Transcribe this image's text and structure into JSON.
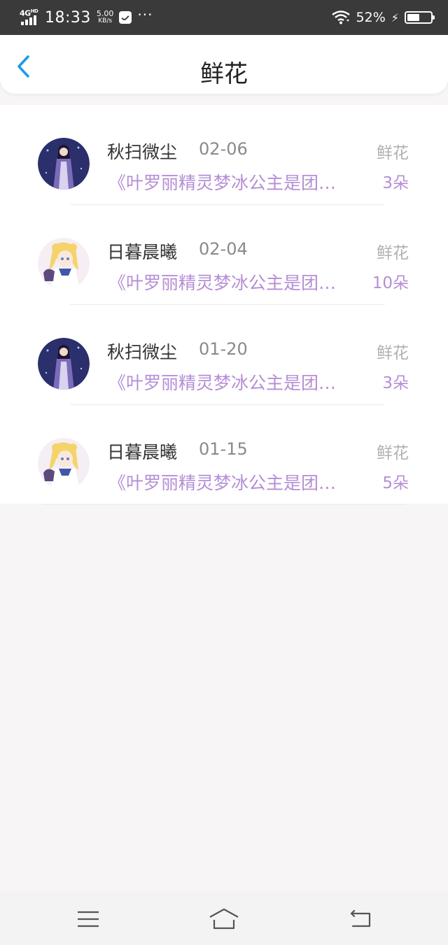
{
  "status_bar": {
    "network": "4G",
    "network_sup": "HD",
    "time": "18:33",
    "speed_value": "5.00",
    "speed_unit": "KB/s",
    "more": "···",
    "battery": "52%",
    "battery_level": 0.52,
    "icons": [
      "signal-icon",
      "message-icon",
      "wifi-icon",
      "charging-icon",
      "battery-icon"
    ]
  },
  "header": {
    "title": "鲜花",
    "back_icon": "chevron-left-icon",
    "accent_color": "#1a9be6"
  },
  "gifts": [
    {
      "name": "秋扫微尘",
      "date": "02-06",
      "type": "鲜花",
      "desc": "《叶罗丽精灵梦冰公主是团…",
      "count": "3朵",
      "avatar": "dark-purple-avatar"
    },
    {
      "name": "日暮晨曦",
      "date": "02-04",
      "type": "鲜花",
      "desc": "《叶罗丽精灵梦冰公主是团…",
      "count": "10朵",
      "avatar": "blonde-anime-avatar"
    },
    {
      "name": "秋扫微尘",
      "date": "01-20",
      "type": "鲜花",
      "desc": "《叶罗丽精灵梦冰公主是团…",
      "count": "3朵",
      "avatar": "dark-purple-avatar"
    },
    {
      "name": "日暮晨曦",
      "date": "01-15",
      "type": "鲜花",
      "desc": "《叶罗丽精灵梦冰公主是团…",
      "count": "5朵",
      "avatar": "blonde-anime-avatar"
    }
  ],
  "nav_bar": {
    "icons": [
      "menu-icon",
      "home-icon",
      "back-icon"
    ]
  },
  "colors": {
    "highlight": "#b58ed6",
    "status_bar": "#3a3a3a",
    "background": "#f7f5f6"
  }
}
